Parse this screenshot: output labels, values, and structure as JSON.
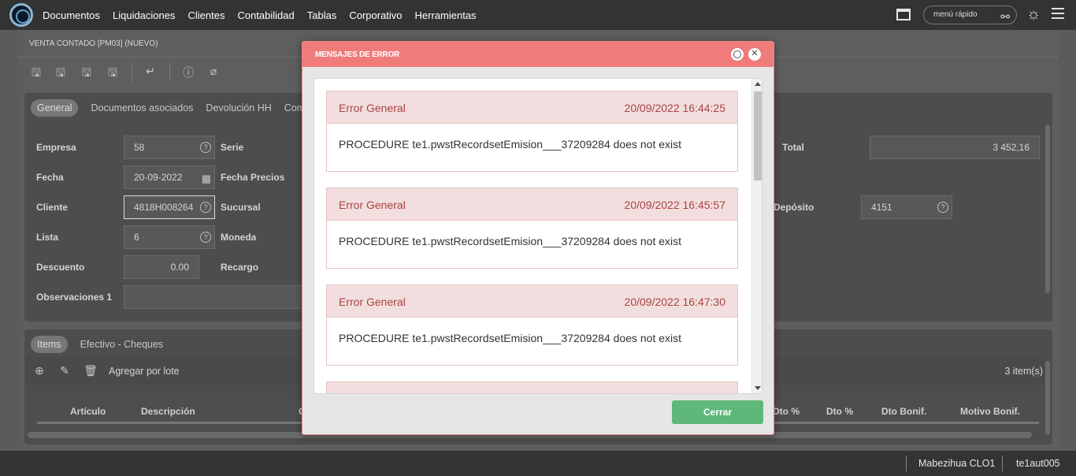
{
  "topbar": {
    "nav": [
      "Documentos",
      "Liquidaciones",
      "Clientes",
      "Contabilidad",
      "Tablas",
      "Corporativo",
      "Herramientas"
    ],
    "quick_menu": "menú rápido"
  },
  "document": {
    "title": "VENTA CONTADO [PM03] (NUEVO)",
    "tabs": [
      "General",
      "Documentos asociados",
      "Devolución HH",
      "Comenta"
    ],
    "fields": {
      "empresa_label": "Empresa",
      "empresa_value": "58",
      "serie_label": "Serie",
      "fecha_label": "Fecha",
      "fecha_value": "20-09-2022",
      "fecha_precios_label": "Fecha Precios",
      "cliente_label": "Cliente",
      "cliente_value": "4818H008264",
      "sucursal_label": "Sucursal",
      "lista_label": "Lista",
      "lista_value": "6",
      "moneda_label": "Moneda",
      "descuento_label": "Descuento",
      "descuento_value": "0.00",
      "recargo_label": "Recargo",
      "observaciones_label": "Observaciones 1",
      "total_label": "Total",
      "total_value": "3 452,16",
      "deposito_label": "Depósito",
      "deposito_value": "4151"
    },
    "items_tabs": [
      "Items",
      "Efectivo - Cheques"
    ],
    "items_toolbar": {
      "batch_label": "Agregar por lote",
      "count": "3 item(s)"
    },
    "columns": {
      "articulo": "Artículo",
      "descripcion": "Descripción",
      "c": "C",
      "dto_pct_1": "Dto %",
      "dto_pct_2": "Dto %",
      "dto_bonif": "Dto Bonif.",
      "motivo_bonif": "Motivo Bonif."
    }
  },
  "statusbar": {
    "user": "Mabezihua CLO1",
    "code": "te1aut005"
  },
  "modal": {
    "title": "MENSAJES DE ERROR",
    "errors": [
      {
        "title": "Error General",
        "date": "20/09/2022 16:44:25",
        "message": "PROCEDURE te1.pwstRecordsetEmision___37209284 does not exist"
      },
      {
        "title": "Error General",
        "date": "20/09/2022 16:45:57",
        "message": "PROCEDURE te1.pwstRecordsetEmision___37209284 does not exist"
      },
      {
        "title": "Error General",
        "date": "20/09/2022 16:47:30",
        "message": "PROCEDURE te1.pwstRecordsetEmision___37209284 does not exist"
      }
    ],
    "close_button": "Cerrar"
  },
  "colors": {
    "modal_header": "#ef7b7b",
    "error_bg": "#f2dede",
    "error_text": "#a94442",
    "close_button": "#5fb87a"
  }
}
